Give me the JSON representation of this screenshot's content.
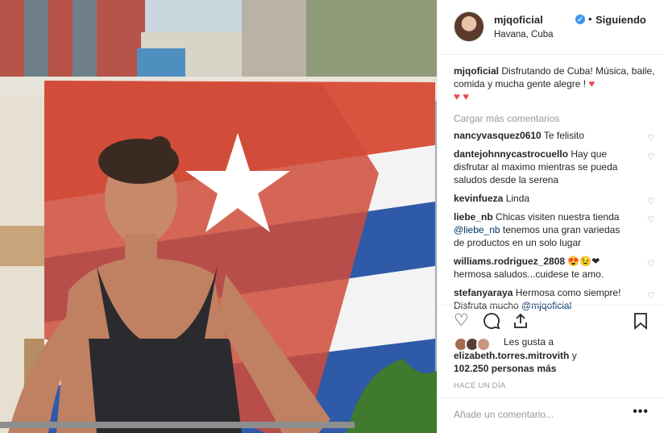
{
  "header": {
    "username": "mjqoficial",
    "verified_icon": "verified-badge-icon",
    "separator": "•",
    "follow_status": "Siguiendo",
    "location": "Havana, Cuba"
  },
  "caption": {
    "username": "mjqoficial",
    "text": "Disfrutando de Cuba! Música, baile, comida y mucha gente alegre !",
    "emoji_1": "♥",
    "emoji_2": "♥ ♥"
  },
  "load_more": "Cargar más comentarios",
  "comments": [
    {
      "user": "nancyvasquez0610",
      "text": "Te felisito"
    },
    {
      "user": "dantejohnnycastrocuello",
      "text": "Hay que disfrutar al maximo mientras se pueda saludos desde la serena"
    },
    {
      "user": "kevinfueza",
      "text": "Linda"
    },
    {
      "user": "liebe_nb",
      "text": "Chicas visiten nuestra tienda",
      "mention": "@liebe_nb",
      "text_after": "tenemos una gran variedas de productos en un solo lugar"
    },
    {
      "user": "williams.rodriguez_2808",
      "emojis": "😍😉❤",
      "text": "hermosa saludos...cuidese te amo."
    },
    {
      "user": "stefanyaraya",
      "text": "Hermosa como siempre! Disfruta mucho",
      "mention": "@mjqoficial"
    }
  ],
  "actions": {
    "like_icon": "heart-outline-icon",
    "comment_icon": "comment-bubble-icon",
    "share_icon": "share-icon",
    "save_icon": "bookmark-icon"
  },
  "likes": {
    "prefix": "Les gusta a",
    "user": "elizabeth.torres.mitrovith",
    "conjunction": "y",
    "count": "102.250 personas más"
  },
  "timestamp": "HACE UN DÍA",
  "add_comment": {
    "placeholder": "Añade un comentario...",
    "more_label": "•••"
  },
  "colors": {
    "verified": "#3897f0",
    "heart": "#ed4956",
    "muted": "#999999",
    "flag_blue": "#2f5aa8",
    "flag_red": "#d9533e"
  }
}
